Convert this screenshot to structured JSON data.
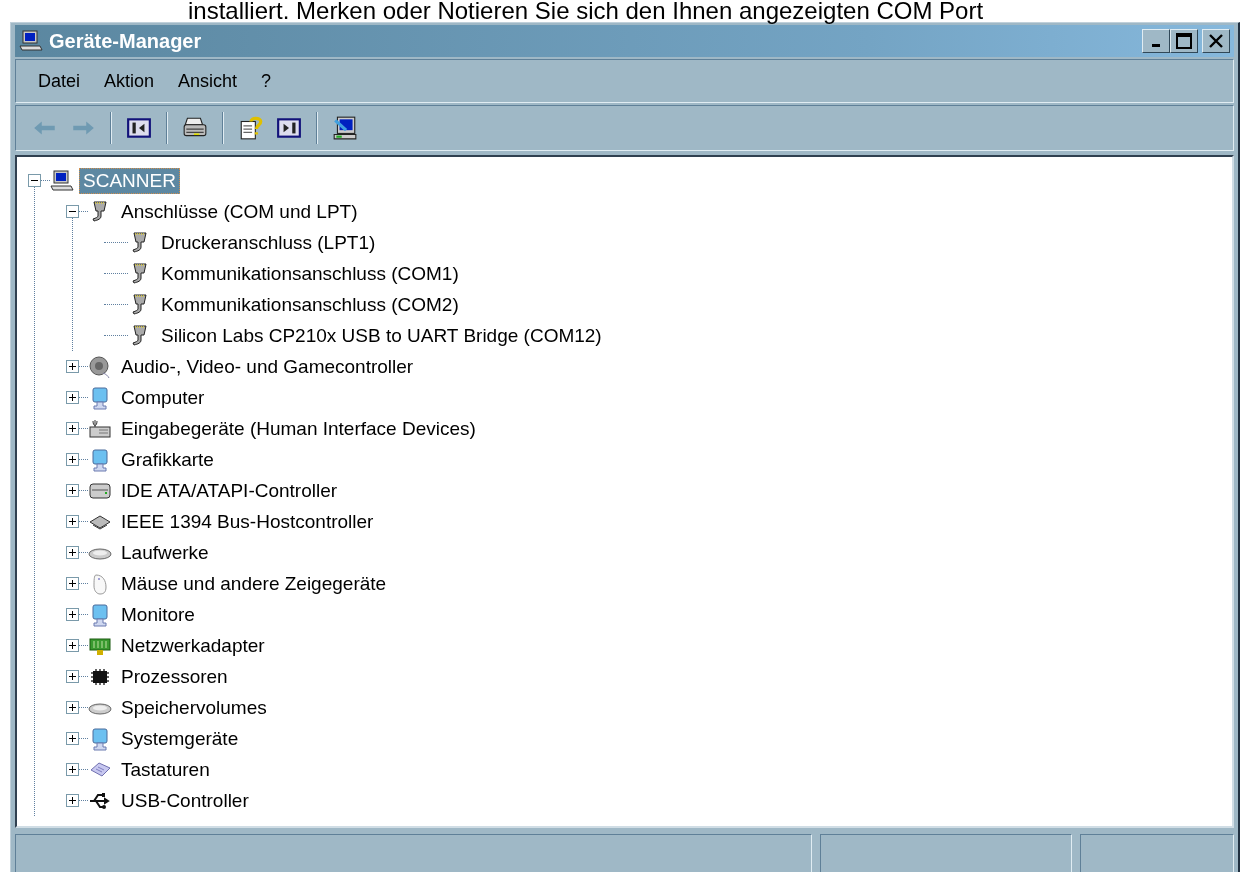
{
  "caption": "installiert. Merken oder Notieren Sie sich den Ihnen angezeigten COM Port",
  "window": {
    "title": "Geräte-Manager"
  },
  "menu": [
    "Datei",
    "Aktion",
    "Ansicht",
    "?"
  ],
  "toolbar": [
    [
      {
        "kind": "back",
        "disabled": true
      },
      {
        "kind": "forward",
        "disabled": true
      }
    ],
    [
      {
        "kind": "tree"
      }
    ],
    [
      {
        "kind": "print"
      }
    ],
    [
      {
        "kind": "help"
      },
      {
        "kind": "pane"
      }
    ],
    [
      {
        "kind": "scan"
      }
    ]
  ],
  "tree": [
    {
      "label": "SCANNER",
      "kind": "computer",
      "selected": true,
      "expanded": true,
      "children": [
        {
          "label": "Anschlüsse (COM und LPT)",
          "kind": "port",
          "selected": false,
          "expanded": true,
          "children": [
            {
              "label": "Druckeranschluss (LPT1)",
              "kind": "port",
              "selected": false
            },
            {
              "label": "Kommunikationsanschluss (COM1)",
              "kind": "port",
              "selected": false
            },
            {
              "label": "Kommunikationsanschluss (COM2)",
              "kind": "port",
              "selected": false
            },
            {
              "label": "Silicon Labs CP210x USB to UART Bridge (COM12)",
              "kind": "port",
              "selected": false
            }
          ]
        },
        {
          "label": "Audio-, Video- und Gamecontroller",
          "kind": "speaker",
          "selected": false,
          "expanded": false
        },
        {
          "label": "Computer",
          "kind": "monitor",
          "selected": false,
          "expanded": false
        },
        {
          "label": "Eingabegeräte (Human Interface Devices)",
          "kind": "hid",
          "selected": false,
          "expanded": false
        },
        {
          "label": "Grafikkarte",
          "kind": "monitor",
          "selected": false,
          "expanded": false
        },
        {
          "label": "IDE ATA/ATAPI-Controller",
          "kind": "ide",
          "selected": false,
          "expanded": false
        },
        {
          "label": "IEEE 1394 Bus-Hostcontroller",
          "kind": "ieee",
          "selected": false,
          "expanded": false
        },
        {
          "label": "Laufwerke",
          "kind": "disk",
          "selected": false,
          "expanded": false
        },
        {
          "label": "Mäuse und andere Zeigegeräte",
          "kind": "mouse",
          "selected": false,
          "expanded": false
        },
        {
          "label": "Monitore",
          "kind": "monitor",
          "selected": false,
          "expanded": false
        },
        {
          "label": "Netzwerkadapter",
          "kind": "network",
          "selected": false,
          "expanded": false
        },
        {
          "label": "Prozessoren",
          "kind": "cpu",
          "selected": false,
          "expanded": false
        },
        {
          "label": "Speichervolumes",
          "kind": "disk",
          "selected": false,
          "expanded": false
        },
        {
          "label": "Systemgeräte",
          "kind": "monitor",
          "selected": false,
          "expanded": false
        },
        {
          "label": "Tastaturen",
          "kind": "keyboard",
          "selected": false,
          "expanded": false
        },
        {
          "label": "USB-Controller",
          "kind": "usb",
          "selected": false,
          "expanded": false
        }
      ]
    }
  ]
}
